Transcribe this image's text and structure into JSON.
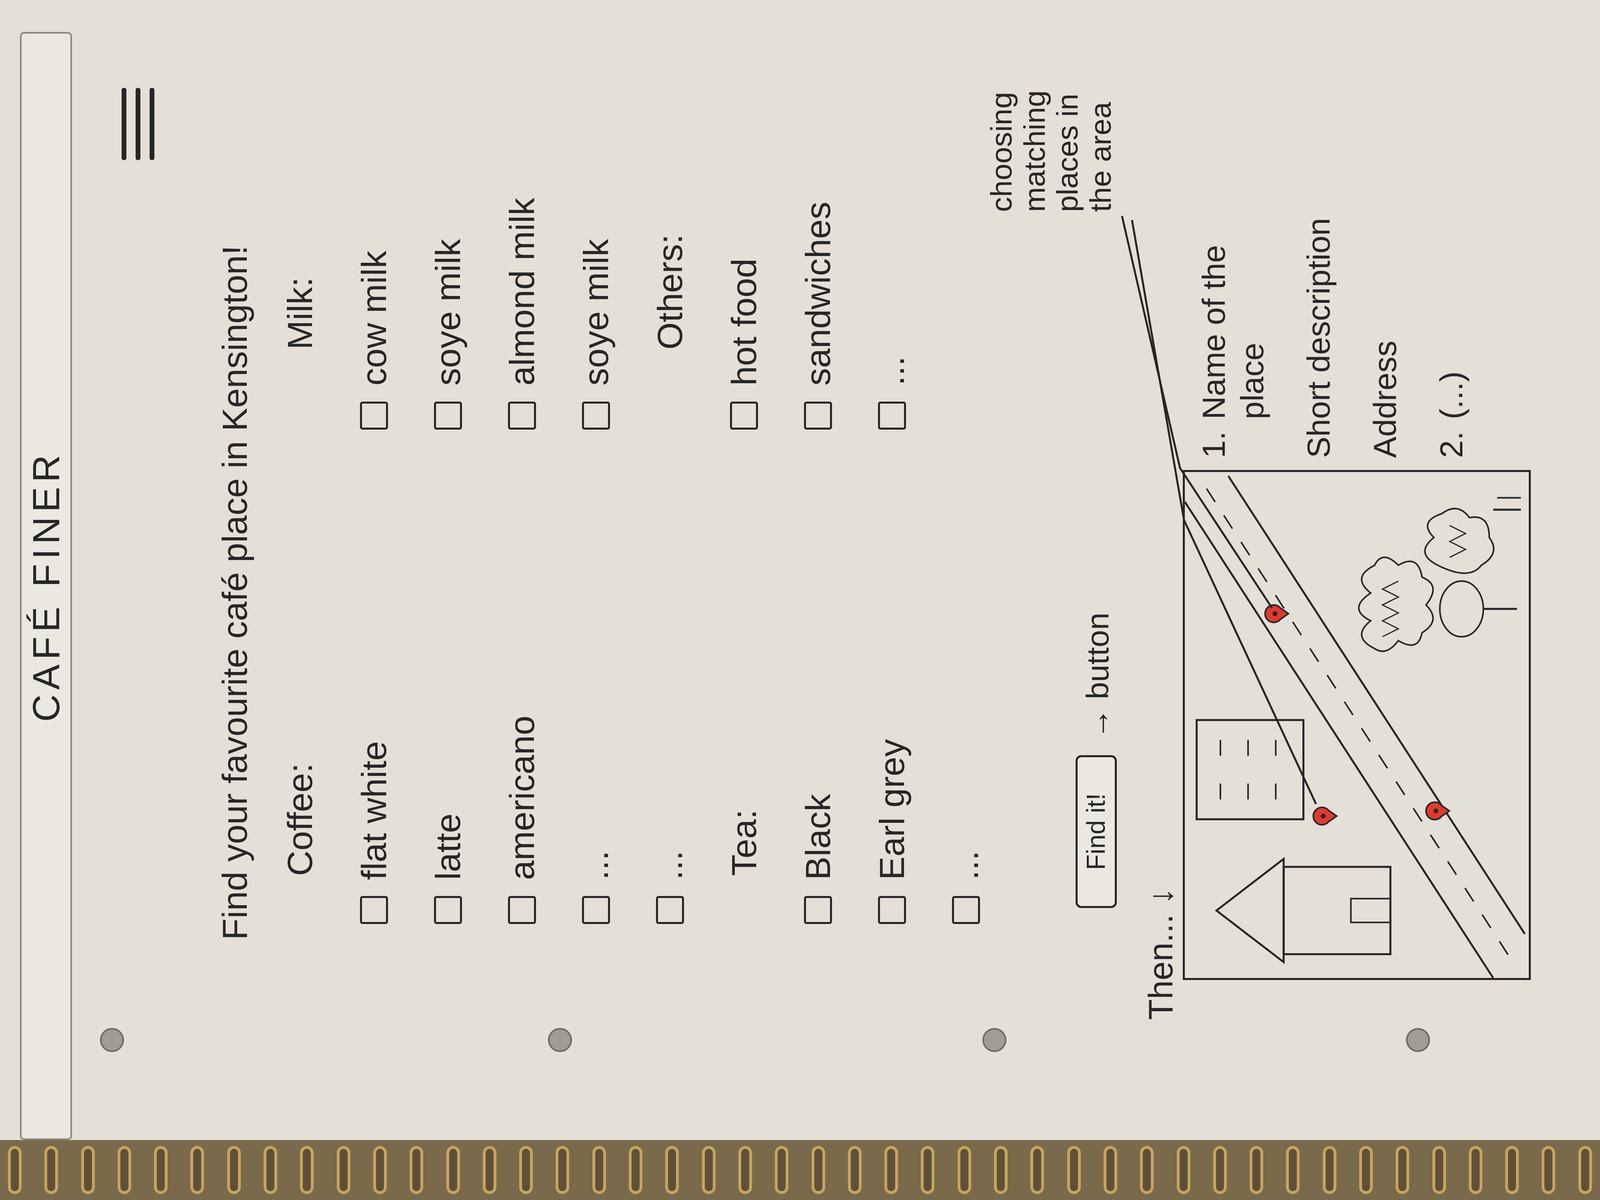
{
  "title": "CAFÉ FINER",
  "headline": "Find your favourite café place in Kensington!",
  "columns": [
    {
      "rows": [
        {
          "kind": "heading",
          "label": "Coffee:"
        },
        {
          "kind": "option",
          "label": "flat white",
          "checked": false
        },
        {
          "kind": "option",
          "label": "latte",
          "checked": false
        },
        {
          "kind": "option",
          "label": "americano",
          "checked": false
        },
        {
          "kind": "option",
          "label": "...",
          "checked": false
        },
        {
          "kind": "option",
          "label": "...",
          "checked": false
        },
        {
          "kind": "heading",
          "label": "Tea:"
        },
        {
          "kind": "option",
          "label": "Black",
          "checked": false
        },
        {
          "kind": "option",
          "label": "Earl grey",
          "checked": false
        },
        {
          "kind": "option",
          "label": "...",
          "checked": false
        }
      ]
    },
    {
      "rows": [
        {
          "kind": "heading",
          "label": "Milk:"
        },
        {
          "kind": "option",
          "label": "cow milk",
          "checked": false
        },
        {
          "kind": "option",
          "label": "soye milk",
          "checked": false
        },
        {
          "kind": "option",
          "label": "almond milk",
          "checked": false
        },
        {
          "kind": "option",
          "label": "soye milk",
          "checked": false
        },
        {
          "kind": "heading",
          "label": "Others:"
        },
        {
          "kind": "option",
          "label": "hot food",
          "checked": false
        },
        {
          "kind": "option",
          "label": "sandwiches",
          "checked": false
        },
        {
          "kind": "option",
          "label": "...",
          "checked": false
        }
      ]
    }
  ],
  "button": {
    "label": "Find it!"
  },
  "notes": {
    "button": "→ button",
    "then": "Then... ↓",
    "map": "choosing matching places in the area"
  },
  "results": [
    {
      "number": "1.",
      "name": "Name of the place",
      "description": "Short description",
      "address": "Address"
    },
    {
      "number": "2.",
      "name": "(...)"
    }
  ]
}
